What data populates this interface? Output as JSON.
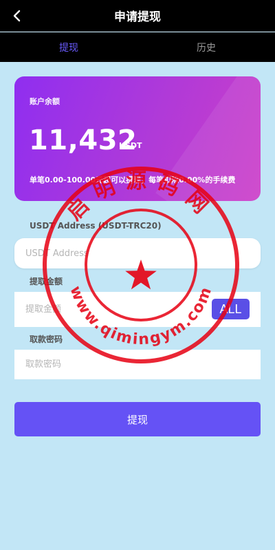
{
  "header": {
    "title": "申请提现",
    "back_icon": "chevron-left-icon"
  },
  "tabs": [
    {
      "label": "提现",
      "active": true
    },
    {
      "label": "历史",
      "active": false
    }
  ],
  "balance_card": {
    "label": "账户余额",
    "amount": "11,432",
    "unit": "USDT",
    "note": "单笔0.00-100.00元起可以提现，每笔扣除0.00%的手续费"
  },
  "address": {
    "label": "USDT Address (USDT-TRC20)",
    "placeholder": "USDT Address",
    "value": ""
  },
  "amount": {
    "label": "提取金额",
    "placeholder": "提取金额",
    "value": "",
    "all_label": "ALL"
  },
  "password": {
    "label": "取款密码",
    "placeholder": "取款密码",
    "value": ""
  },
  "submit_label": "提现",
  "watermark": {
    "top_text": "启明源码网",
    "bottom_text": "www.qimingym.com"
  },
  "colors": {
    "header_bg": "#000000",
    "page_bg": "#c2e6f6",
    "accent": "#6552f5",
    "card_gradient_start": "#8f2ef0",
    "card_gradient_end": "#cc3ec8",
    "stamp_red": "#e60012"
  }
}
